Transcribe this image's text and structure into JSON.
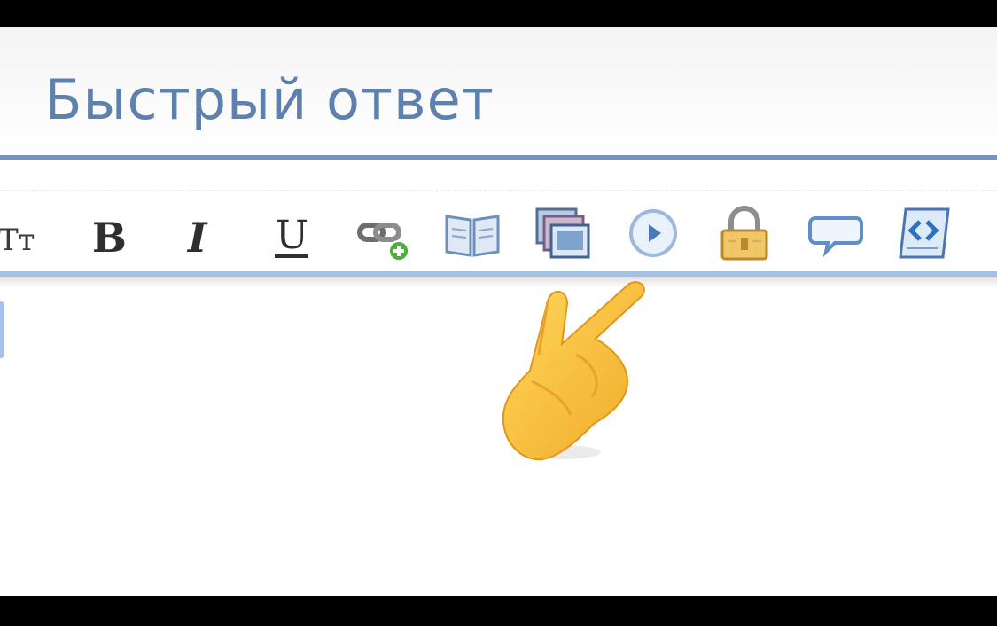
{
  "page": {
    "title": "Быстрый ответ"
  },
  "toolbar": {
    "buttons": [
      {
        "name": "font-size-button",
        "label": "Tт"
      },
      {
        "name": "bold-button",
        "label": "B"
      },
      {
        "name": "italic-button",
        "label": "I"
      },
      {
        "name": "underline-button",
        "label": "U"
      },
      {
        "name": "insert-link-button",
        "icon": "link-add-icon"
      },
      {
        "name": "book-button",
        "icon": "open-book-icon"
      },
      {
        "name": "gallery-button",
        "icon": "image-gallery-icon"
      },
      {
        "name": "media-button",
        "icon": "play-icon"
      },
      {
        "name": "hide-button",
        "icon": "padlock-icon"
      },
      {
        "name": "quote-button",
        "icon": "speech-bubble-icon"
      },
      {
        "name": "code-button",
        "icon": "code-scroll-icon"
      }
    ]
  },
  "overlay": {
    "icon": "pointing-hand-emoji"
  },
  "colors": {
    "title": "#5d80ad",
    "title_rule": "#7195c7",
    "toolbar_rule": "#a4c0e6"
  }
}
